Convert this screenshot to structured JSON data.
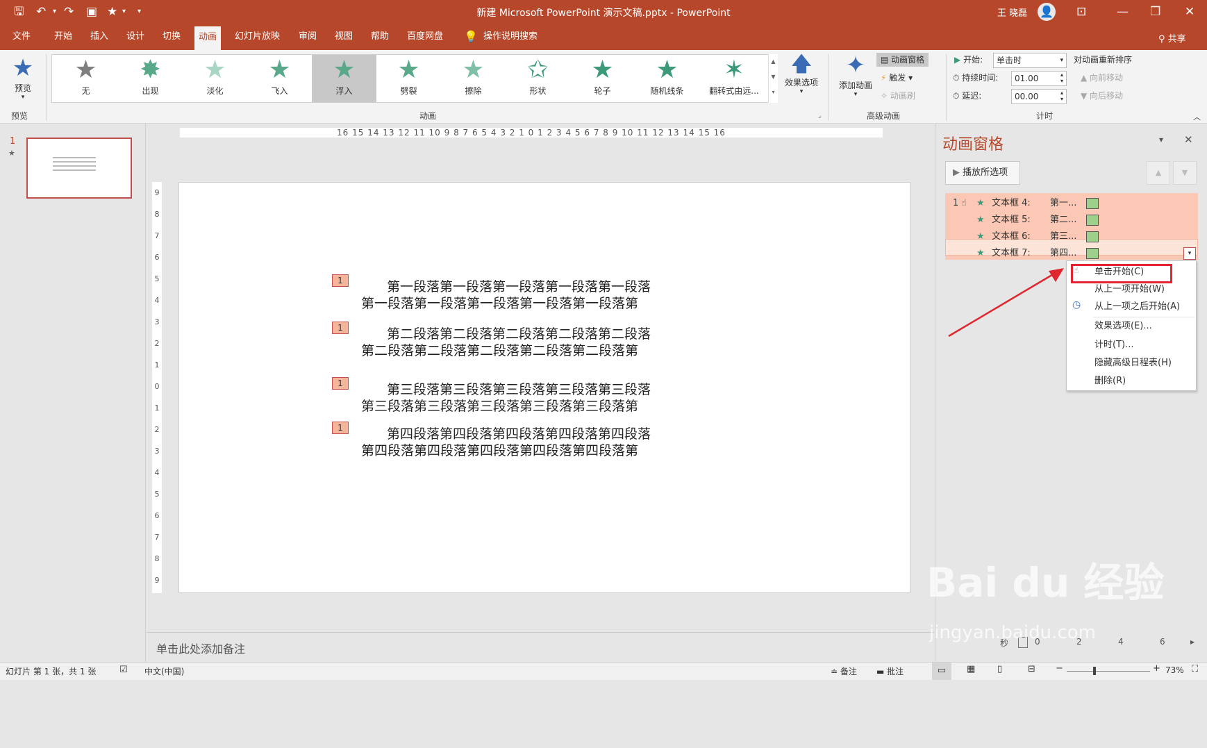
{
  "title": {
    "text": "新建 Microsoft PowerPoint 演示文稿.pptx  -  PowerPoint",
    "user": "王 晓磊"
  },
  "tabs": [
    "文件",
    "开始",
    "插入",
    "设计",
    "切换",
    "动画",
    "幻灯片放映",
    "审阅",
    "视图",
    "帮助",
    "百度网盘"
  ],
  "active_tab": "动画",
  "tell_me": "操作说明搜索",
  "share": "共享",
  "ribbon": {
    "preview_label": "预览",
    "preview_group": "预览",
    "animations": [
      "无",
      "出现",
      "淡化",
      "飞入",
      "浮入",
      "劈裂",
      "擦除",
      "形状",
      "轮子",
      "随机线条",
      "翻转式由远..."
    ],
    "selected_animation": "浮入",
    "effect_options": "效果选项",
    "animation_group": "动画",
    "add_animation": "添加动画",
    "animation_pane_btn": "动画窗格",
    "trigger": "触发",
    "animation_painter": "动画刷",
    "advanced_group": "高级动画",
    "start_label": "开始:",
    "start_value": "单击时",
    "duration_label": "持续时间:",
    "duration_value": "01.00",
    "delay_label": "延迟:",
    "delay_value": "00.00",
    "reorder": "对动画重新排序",
    "move_earlier": "向前移动",
    "move_later": "向后移动",
    "timing_group": "计时"
  },
  "colors": {
    "accent": "#b7472a",
    "highlight": "#fac8b4",
    "menu_box": "#e0262e"
  },
  "thumb": {
    "number": "1"
  },
  "ruler_h": "16 15 14 13 12 11 10 9 8 7 6 5 4 3 2 1 0 1 2 3 4 5 6 7 8 9 10 11 12 13 14 15 16",
  "ruler_v": [
    "9",
    "8",
    "7",
    "6",
    "5",
    "4",
    "3",
    "2",
    "1",
    "0",
    "1",
    "2",
    "3",
    "4",
    "5",
    "6",
    "7",
    "8",
    "9"
  ],
  "slide": {
    "paragraphs": [
      {
        "tag": "1",
        "line1": "第一段落第一段落第一段落第一段落第一段落",
        "line2": "第一段落第一段落第一段落第一段落第一段落第"
      },
      {
        "tag": "1",
        "line1": "第二段落第二段落第二段落第二段落第二段落",
        "line2": "第二段落第二段落第二段落第二段落第二段落第"
      },
      {
        "tag": "1",
        "line1": "第三段落第三段落第三段落第三段落第三段落",
        "line2": "第三段落第三段落第三段落第三段落第三段落第"
      },
      {
        "tag": "1",
        "line1": "第四段落第四段落第四段落第四段落第四段落",
        "line2": "第四段落第四段落第四段落第四段落第四段落第"
      }
    ]
  },
  "notes": "单击此处添加备注",
  "pane": {
    "title": "动画窗格",
    "play_btn": "播放所选项",
    "items": [
      {
        "num": "1",
        "name": "文本框 4:",
        "text": "第一..."
      },
      {
        "num": "",
        "name": "文本框 5:",
        "text": "第二..."
      },
      {
        "num": "",
        "name": "文本框 6:",
        "text": "第三..."
      },
      {
        "num": "",
        "name": "文本框 7:",
        "text": "第四..."
      }
    ],
    "menu": [
      "单击开始(C)",
      "从上一项开始(W)",
      "从上一项之后开始(A)",
      "效果选项(E)...",
      "计时(T)...",
      "隐藏高级日程表(H)",
      "删除(R)"
    ],
    "timeline_ticks": [
      "秒",
      "0",
      "2",
      "4",
      "6"
    ]
  },
  "status": {
    "slide_info": "幻灯片 第 1 张，共 1 张",
    "language": "中文(中国)",
    "notes_btn": "备注",
    "comments_btn": "批注",
    "zoom": "73%"
  },
  "watermark": {
    "brand": "Bai du 经验",
    "url": "jingyan.baidu.com"
  }
}
